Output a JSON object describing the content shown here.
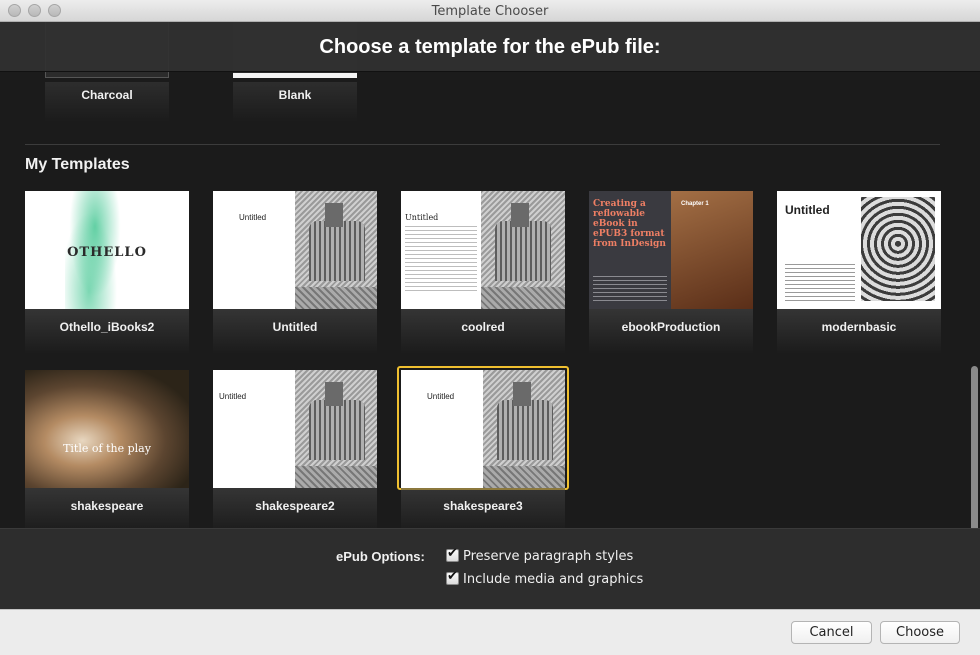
{
  "window": {
    "title": "Template Chooser"
  },
  "header": {
    "title": "Choose a template for the ePub file:"
  },
  "builtin_templates": [
    {
      "label": "Charcoal"
    },
    {
      "label": "Blank"
    }
  ],
  "my_templates": {
    "section_title": "My Templates",
    "items": [
      {
        "label": "Othello_iBooks2",
        "thumb_text": "OTHELLO"
      },
      {
        "label": "Untitled",
        "thumb_text": "Untitled"
      },
      {
        "label": "coolred",
        "thumb_text": "Untitled"
      },
      {
        "label": "ebookProduction",
        "thumb_text": "Creating a reflowable eBook in ePUB3 format from InDesign",
        "thumb_chapter": "Chapter 1"
      },
      {
        "label": "modernbasic",
        "thumb_text": "Untitled"
      },
      {
        "label": "shakespeare",
        "thumb_text": "Title of the play"
      },
      {
        "label": "shakespeare2",
        "thumb_text": "Untitled"
      },
      {
        "label": "shakespeare3",
        "thumb_text": "Untitled",
        "selected": true
      }
    ]
  },
  "options": {
    "label": "ePub Options:",
    "checkboxes": [
      {
        "label": "Preserve paragraph styles",
        "checked": true
      },
      {
        "label": "Include media and graphics",
        "checked": true
      }
    ]
  },
  "buttons": {
    "cancel": "Cancel",
    "choose": "Choose"
  },
  "colors": {
    "selection": "#f3c530",
    "background": "#1b1b1b",
    "accent_ebook": "#ef7f64"
  }
}
